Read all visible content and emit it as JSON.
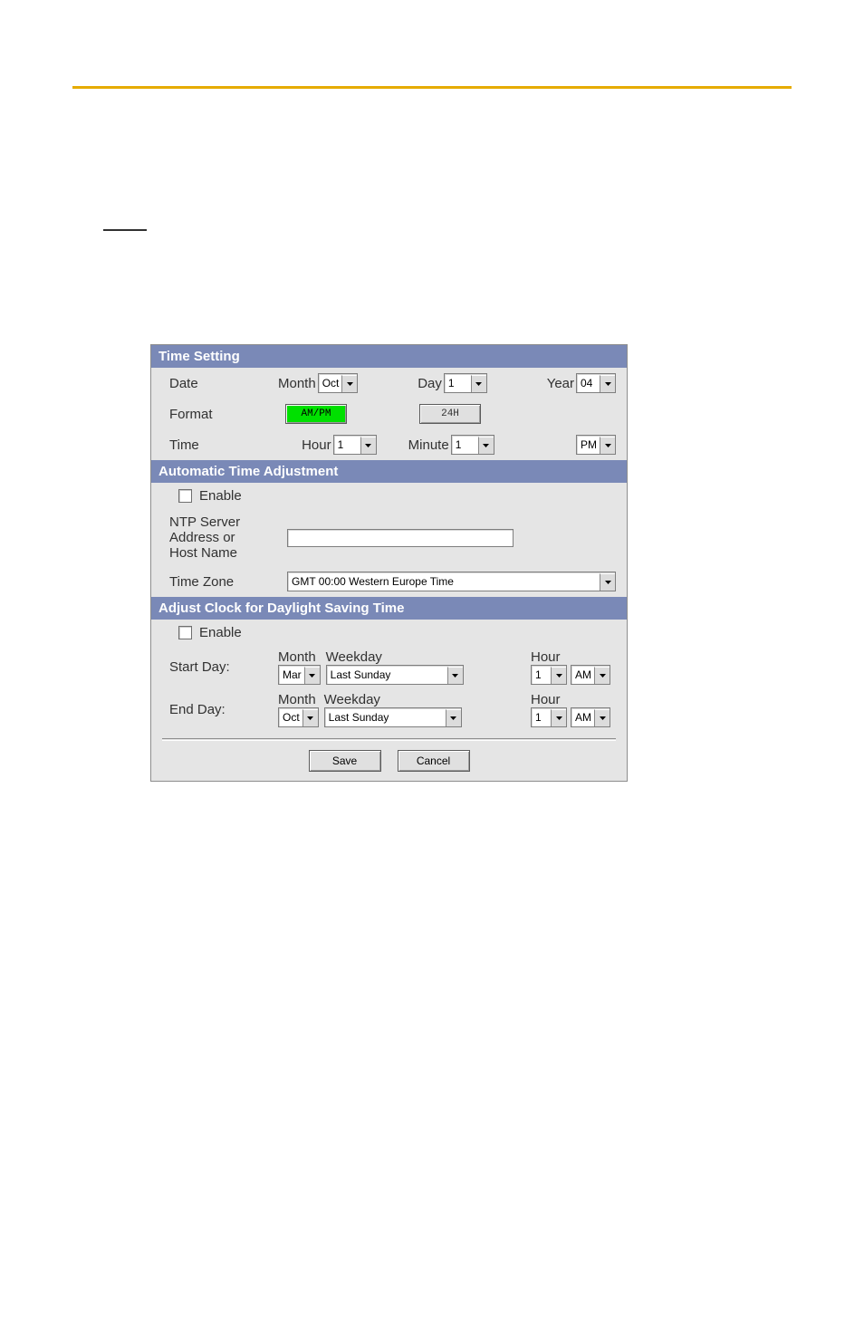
{
  "sections": {
    "time_setting": "Time Setting",
    "auto_adjust": "Automatic Time Adjustment",
    "dst": "Adjust Clock for Daylight Saving Time"
  },
  "date": {
    "row_label": "Date",
    "month_label": "Month",
    "month_value": "Oct",
    "day_label": "Day",
    "day_value": "1",
    "year_label": "Year",
    "year_value": "04"
  },
  "format": {
    "row_label": "Format",
    "ampm_label": "AM/PM",
    "h24_label": "24H"
  },
  "time": {
    "row_label": "Time",
    "hour_label": "Hour",
    "hour_value": "1",
    "minute_label": "Minute",
    "minute_value": "1",
    "ampm_value": "PM"
  },
  "auto": {
    "enable_label": "Enable",
    "ntp_label_l1": "NTP Server",
    "ntp_label_l2": "Address or",
    "ntp_label_l3": "Host Name",
    "ntp_value": "",
    "tz_label": "Time Zone",
    "tz_value": "GMT 00:00 Western Europe Time"
  },
  "dst": {
    "enable_label": "Enable",
    "start_label": "Start Day:",
    "end_label": "End Day:",
    "month_label": "Month",
    "weekday_label": "Weekday",
    "hour_label": "Hour",
    "start_month": "Mar",
    "start_weekday": "Last Sunday",
    "start_hour": "1",
    "start_ampm": "AM",
    "end_month": "Oct",
    "end_weekday": "Last Sunday",
    "end_hour": "1",
    "end_ampm": "AM"
  },
  "buttons": {
    "save": "Save",
    "cancel": "Cancel"
  }
}
